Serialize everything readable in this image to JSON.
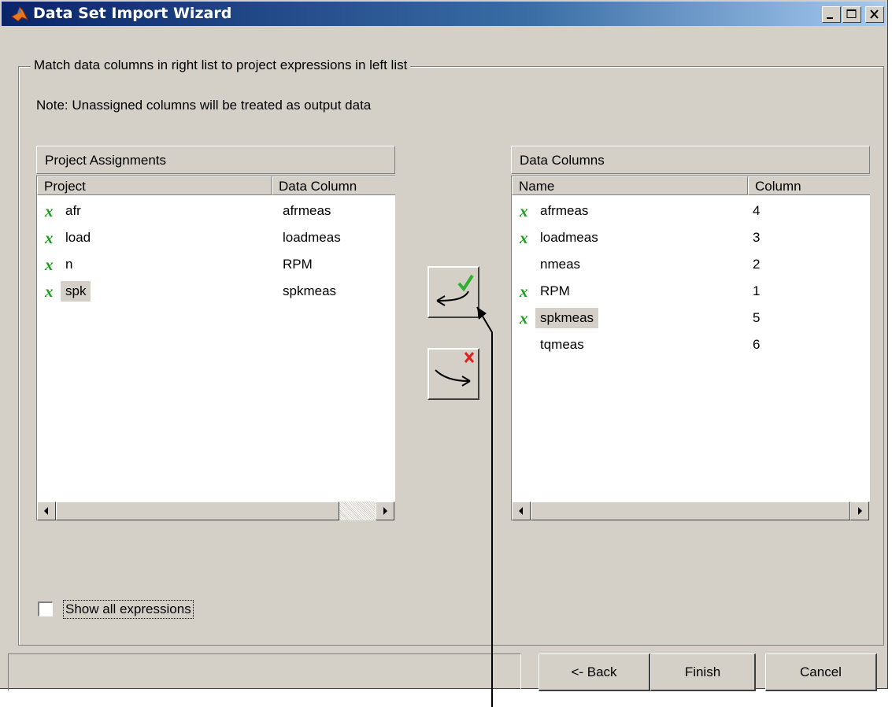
{
  "window": {
    "title": "Data Set Import Wizard"
  },
  "group": {
    "label": "Match data columns in right list to project expressions in left list",
    "note": "Note: Unassigned columns will be treated as output data"
  },
  "left_panel": {
    "title": "Project Assignments",
    "columns": [
      "Project",
      "Data Column"
    ],
    "rows": [
      {
        "mark": "x",
        "name": "afr",
        "value": "afrmeas"
      },
      {
        "mark": "x",
        "name": "load",
        "value": "loadmeas"
      },
      {
        "mark": "x",
        "name": "n",
        "value": "RPM"
      },
      {
        "mark": "x",
        "name": "spk",
        "value": "spkmeas"
      }
    ]
  },
  "right_panel": {
    "title": "Data Columns",
    "columns": [
      "Name",
      "Column"
    ],
    "rows": [
      {
        "mark": "x",
        "name": "afrmeas",
        "value": "4"
      },
      {
        "mark": "x",
        "name": "loadmeas",
        "value": "3"
      },
      {
        "mark": "",
        "name": "nmeas",
        "value": "2"
      },
      {
        "mark": "x",
        "name": "RPM",
        "value": "1"
      },
      {
        "mark": "x",
        "name": "spkmeas",
        "value": "5"
      },
      {
        "mark": "",
        "name": "tqmeas",
        "value": "6"
      }
    ]
  },
  "checkbox": {
    "label": "Show all expressions",
    "checked": false
  },
  "buttons": {
    "back": "<- Back",
    "finish": "Finish",
    "cancel": "Cancel"
  },
  "icons": {
    "assign": "assign-arrow-check-icon",
    "unassign": "unassign-arrow-cross-icon"
  },
  "colors": {
    "mark": "#1aa01a",
    "face": "#d4d0c8",
    "title_start": "#0a246a",
    "title_end": "#a6caf0"
  }
}
